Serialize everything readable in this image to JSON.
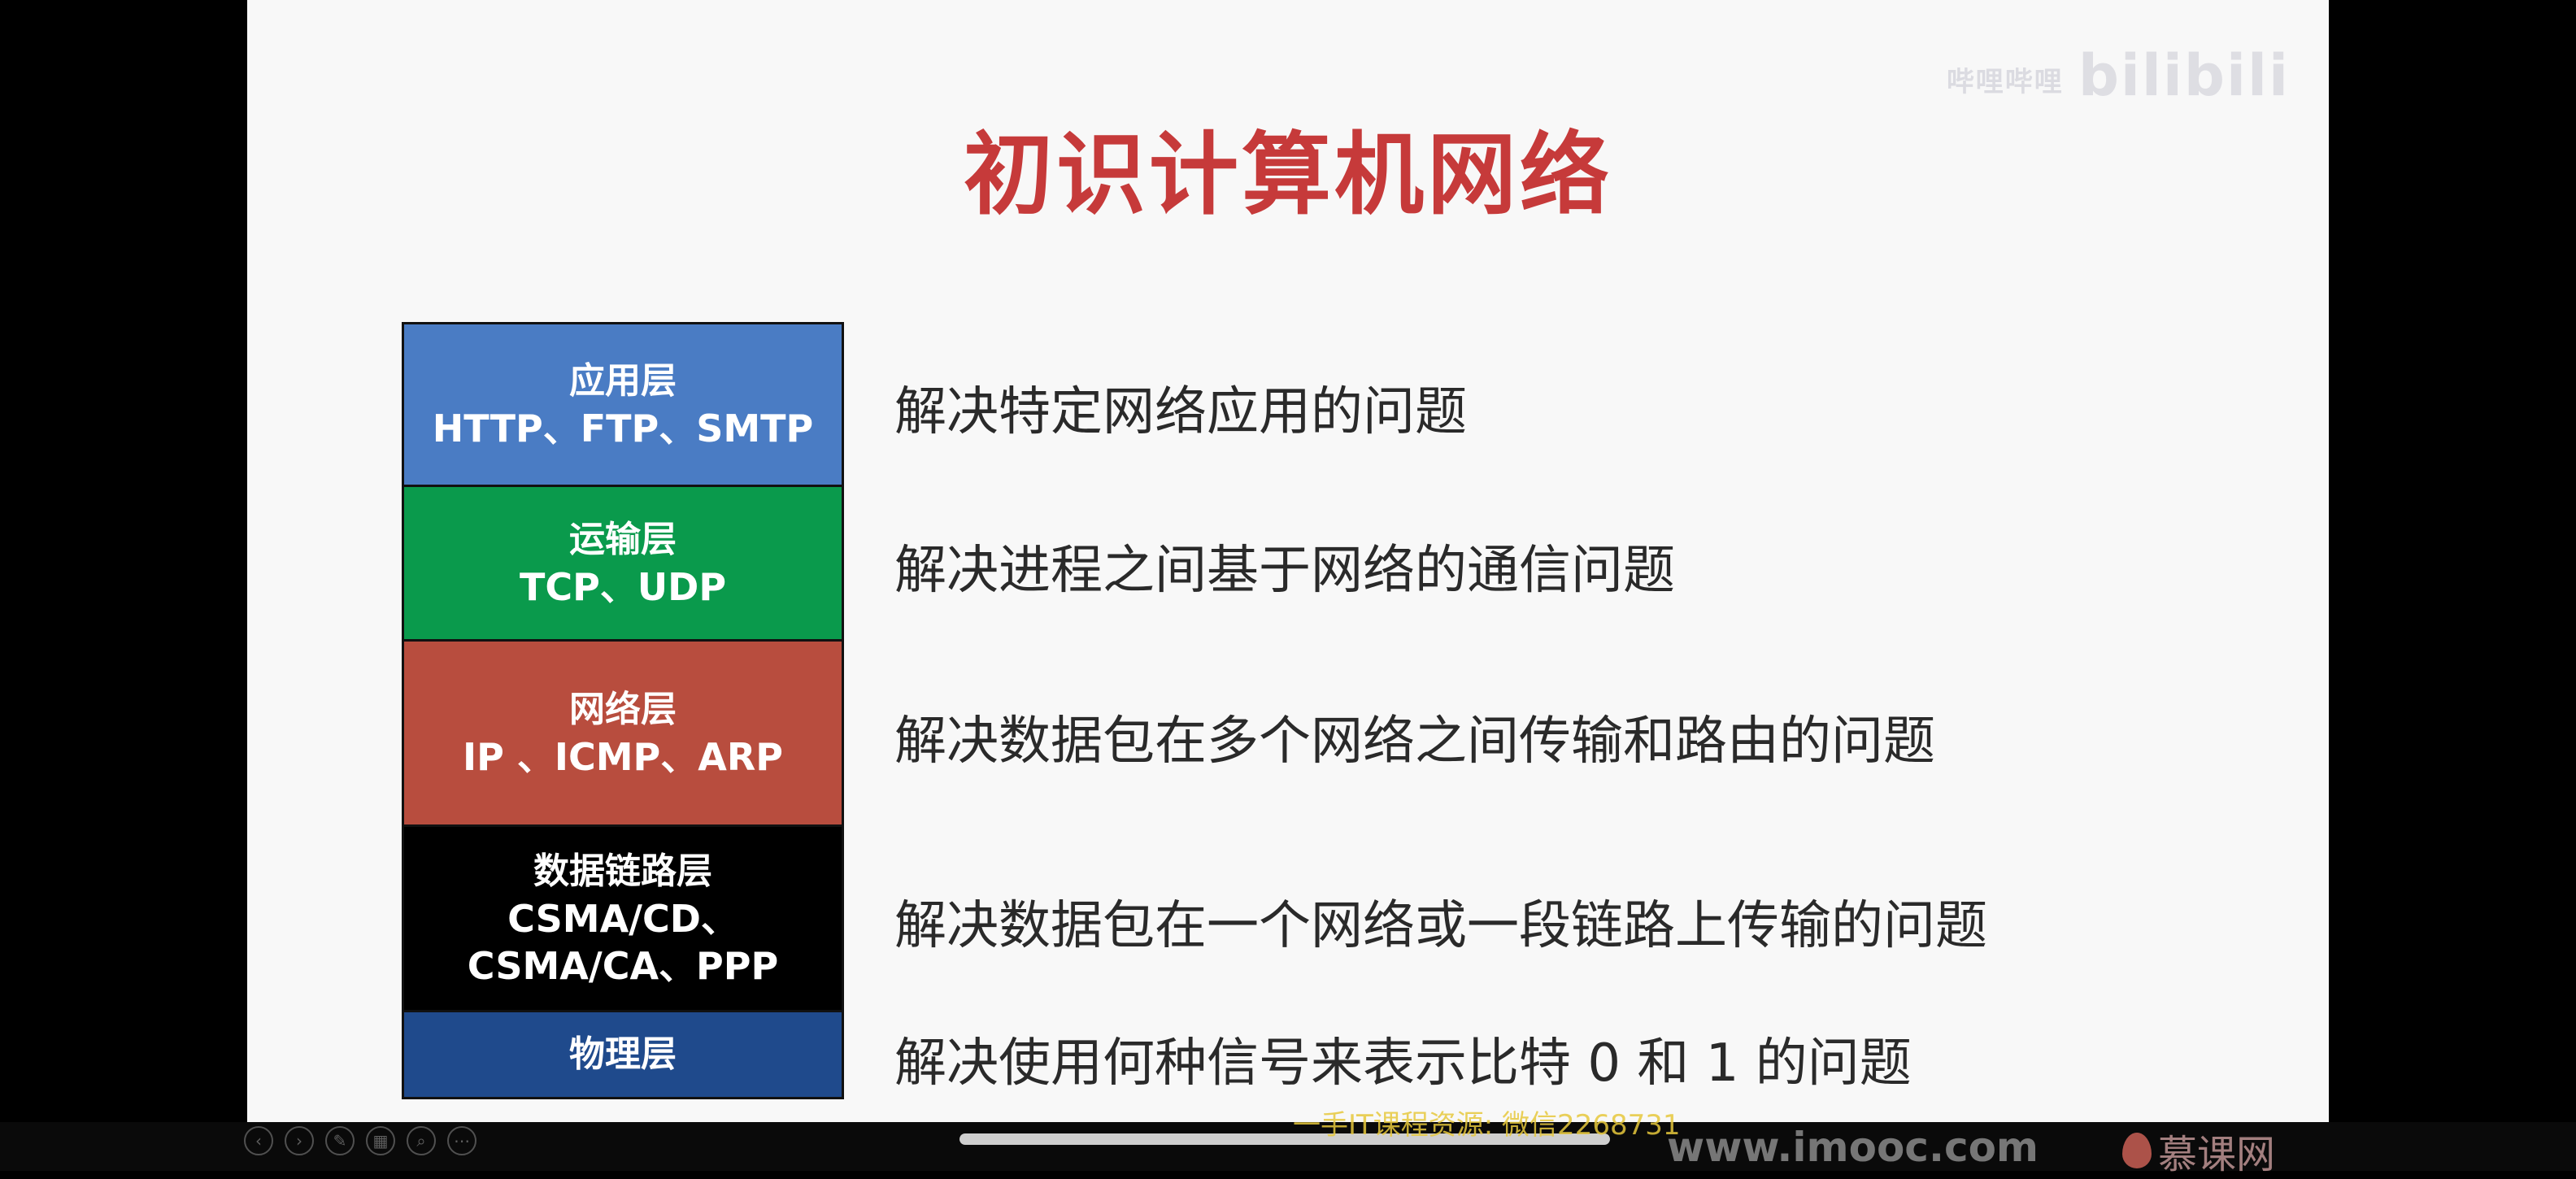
{
  "slide": {
    "title": "初识计算机网络",
    "watermark": {
      "small": "哔哩哔哩",
      "brand": "bilibili"
    }
  },
  "layers": [
    {
      "name": "应用层",
      "protocols": "HTTP、FTP、SMTP",
      "description": "解决特定网络应用的问题",
      "color": "#4a7cc4"
    },
    {
      "name": "运输层",
      "protocols": "TCP、UDP",
      "description": "解决进程之间基于网络的通信问题",
      "color": "#0a9a4c"
    },
    {
      "name": "网络层",
      "protocols": "IP 、ICMP、ARP",
      "description": "解决数据包在多个网络之间传输和路由的问题",
      "color": "#b84d3e"
    },
    {
      "name": "数据链路层",
      "protocols": "CSMA/CD、",
      "protocols2": "CSMA/CA、PPP",
      "description": "解决数据包在一个网络或一段链路上传输的问题",
      "color": "#000000"
    },
    {
      "name": "物理层",
      "protocols": "",
      "description": "解决使用何种信号来表示比特 0 和 1 的问题",
      "color": "#1f4a8c"
    }
  ],
  "footer": {
    "resource_note": "一手IT课程资源: 微信2268731",
    "url": "www.imooc.com",
    "brand": "慕课网"
  }
}
